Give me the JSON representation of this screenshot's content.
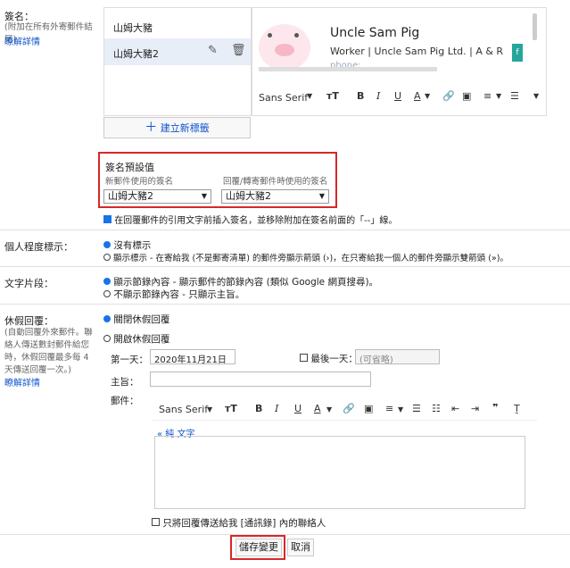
{
  "signature": {
    "label": "簽名：",
    "sub": "(附加在所有外寄郵件結尾)",
    "learn_more": "瞭解詳情",
    "list": [
      "山姆大豬",
      "山姆大豬2"
    ],
    "card_name": "Uncle Sam Pig",
    "card_title": "Worker | Uncle Sam Pig Ltd. | A & R",
    "card_phone": "phone:",
    "create_new": "建立新標籤",
    "toolbar": {
      "font": "Sans Serif"
    }
  },
  "defaults": {
    "title": "簽名預設值",
    "new_label": "新郵件使用的簽名",
    "reply_label": "回覆/轉寄郵件時使用的簽名",
    "new_value": "山姆大豬2",
    "reply_value": "山姆大豬2",
    "insert_text": "在回覆郵件的引用文字前插入簽名，並移除附加在簽名前面的「--」線。"
  },
  "personal": {
    "label": "個人程度標示：",
    "opt1": "沒有標示",
    "opt2": "顯示標示 - 在寄給我 (不是郵寄清單) 的郵件旁顯示箭頭 (›)，在只寄給我一個人的郵件旁顯示雙箭頭 (»)。"
  },
  "snippets": {
    "label": "文字片段：",
    "opt1": "顯示節錄內容 - 顯示郵件的節錄內容 (類似 Google 網頁搜尋)。",
    "opt2": "不顯示節錄內容 - 只顯示主旨。"
  },
  "vacation": {
    "label": "休假回覆：",
    "sub": "(自動回覆外來郵件。聯絡人傳送數封郵件給您時，休假回覆最多每 4 天傳送回覆一次。)",
    "learn_more": "瞭解詳情",
    "off": "關閉休假回覆",
    "on": "開啟休假回覆",
    "first_day_label": "第一天：",
    "first_day": "2020年11月21日",
    "last_day_label": "最後一天：",
    "last_day_placeholder": "(可省略)",
    "subject_label": "主旨：",
    "message_label": "郵件：",
    "plain_text": "« 純 文字",
    "font": "Sans Serif",
    "contacts_only": "只將回覆傳送給我 [通訊錄] 內的聯絡人"
  },
  "buttons": {
    "save": "儲存變更",
    "cancel": "取消"
  },
  "colors": {
    "accent": "#1a73e8",
    "highlight": "#d62828",
    "teal": "#26a69a"
  }
}
